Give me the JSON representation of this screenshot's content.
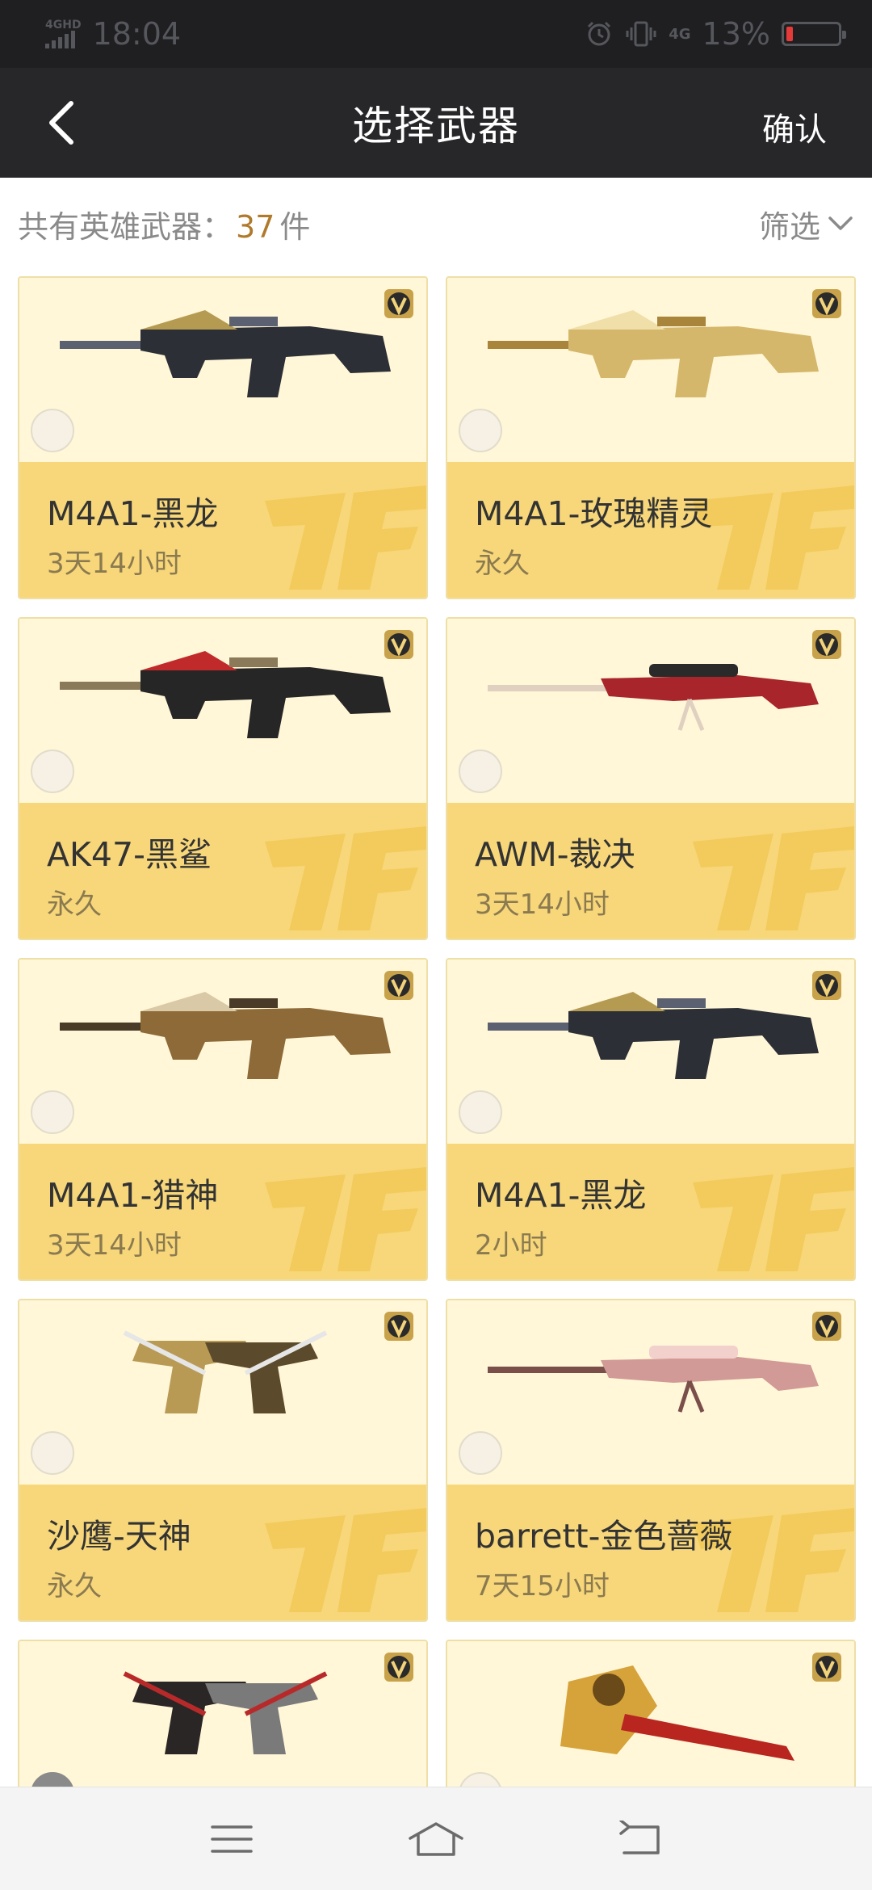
{
  "status_bar": {
    "network": "4GHD",
    "time": "18:04",
    "net_type": "4G",
    "battery_percent": "13%",
    "battery_level": 0.13,
    "icons": [
      "alarm-icon",
      "vibrate-icon",
      "signal-icon",
      "battery-icon"
    ]
  },
  "header": {
    "title": "选择武器",
    "confirm_label": "确认",
    "back_icon": "chevron-left-icon"
  },
  "summary": {
    "prefix": "共有英雄武器：",
    "count": "37",
    "unit": "件",
    "filter_label": "筛选"
  },
  "colors": {
    "header_bg": "#27272a",
    "card_top_bg": "#fff7d8",
    "card_bottom_bg": "#f7d77a",
    "accent_count": "#b07a2b"
  },
  "weapons": [
    {
      "name": "M4A1-黑龙",
      "duration": "3天14小时",
      "selected": false,
      "art": "rifle-dark"
    },
    {
      "name": "M4A1-玫瑰精灵",
      "duration": "永久",
      "selected": false,
      "art": "rifle-gold"
    },
    {
      "name": "AK47-黑鲨",
      "duration": "永久",
      "selected": false,
      "art": "ak-dark"
    },
    {
      "name": "AWM-裁决",
      "duration": "3天14小时",
      "selected": false,
      "art": "sniper-red"
    },
    {
      "name": "M4A1-猎神",
      "duration": "3天14小时",
      "selected": false,
      "art": "rifle-bronze"
    },
    {
      "name": "M4A1-黑龙",
      "duration": "2小时",
      "selected": false,
      "art": "rifle-dark"
    },
    {
      "name": "沙鹰-天神",
      "duration": "永久",
      "selected": false,
      "art": "pistols-gold"
    },
    {
      "name": "barrett-金色蔷薇",
      "duration": "7天15小时",
      "selected": false,
      "art": "barrett-pink"
    },
    {
      "name": "",
      "duration": "",
      "selected": true,
      "art": "pistol-dark"
    },
    {
      "name": "",
      "duration": "",
      "selected": false,
      "art": "axe-gold"
    }
  ],
  "nav": {
    "menu_icon": "menu-icon",
    "home_icon": "home-icon",
    "back_icon": "back-icon"
  }
}
